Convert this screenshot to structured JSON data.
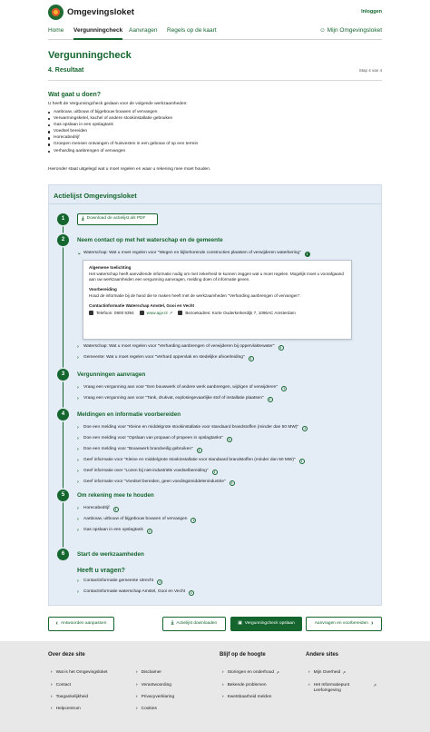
{
  "header": {
    "brand": "Omgevingsloket",
    "login": "Inloggen",
    "nav": [
      "Home",
      "Vergunningcheck",
      "Aanvragen",
      "Regels op de kaart"
    ],
    "mijn": "Mijn Omgevingsloket"
  },
  "page": {
    "title": "Vergunningcheck",
    "subtitle": "4. Resultaat",
    "step": "Stap 4 van 4"
  },
  "intro": {
    "heading": "Wat gaat u doen?",
    "text": "U heeft de Vergunningcheck gedaan voor de volgende werkzaamheden:",
    "bullets": [
      "Aanbouw, uitbouw of bijgebouw bouwen of vervangen",
      "Verwarmingsketel, kachel of andere stookinstallatie gebruiken",
      "Gas opslaan in een opslagtank",
      "Voedsel bereiden",
      "Horecabedrijf",
      "Groepen mensen ontvangen of huisvesten in een gebouw of op een terrein",
      "Verharding aanbrengen of vervangen"
    ],
    "outro": "Hieronder staat uitgelegd wat u moet regelen en waar u rekening mee moet houden."
  },
  "actielijst": {
    "title": "Actielijst Omgevingsloket",
    "step1": {
      "num": "1",
      "button": "Download de actielijst als PDF"
    },
    "step2": {
      "num": "2",
      "title": "Neem contact op met het waterschap en de gemeente",
      "open_item": "Waterschap: Wat u moet regelen voor \"Wegen en bijbehorende constructies plaatsen of verwijderen waterkering\"",
      "box": {
        "h1": "Algemene toelichting",
        "p1": "Het waterschap heeft aanvullende informatie nodig om met zekerheid te kunnen zeggen wat u moet regelen. Mogelijk moet u vooraf­gaand aan uw werkzaamheden een vergunning aanvragen, melding doen of informatie geven.",
        "h2": "Voorbereiding",
        "p2": "Houd de informatie bij de hand die te maken heeft met de werkzaamheden \"Verharding aanbrengen of vervangen\".",
        "h3": "Contactinformatie Waterschap Amstel, Gooi en Vecht",
        "phone": "Telefoon: 0900 9394",
        "web": "www.agv.nl",
        "address": "Bezoekadres: Korte Ouderkerkerdijk 7, 1096AC Amsterdam"
      },
      "items": [
        "Waterschap: Wat u moet regelen voor \"Verharding aanbrengen of verwijderen bij oppervlaktewater\"",
        "Gemeente: Wat u moet regelen voor \"Verhard oppervlak en stedelijke afvoerleiding\""
      ]
    },
    "step3": {
      "num": "3",
      "title": "Vergunningen aanvragen",
      "items": [
        "Vraag een vergunning aan voor \"Een bouwwerk of andere werk aanbrengen, wijzigen of verwijderen\"",
        "Vraag een vergunning aan voor \"Tank, drukvat, explosiegevaarlijke stof of installatie plaatsen\""
      ]
    },
    "step4": {
      "num": "4",
      "title": "Meldingen en informatie voorbereiden",
      "items": [
        "Doe een melding voor \"Kleine en middelgrote stookinstallatie voor standaard brandstoffen (minder dan 50 MW)\"",
        "Doe een melding voor \"Opslaan van propaan of propeen in opslagtanks\"",
        "Doe een melding voor \"Bouwwerk brandveilig gebruiken\"",
        "Geef informatie voor \"Kleine en middelgrote stookinstallatie voor standaard brandstoffen (minder dan 50 MW)\"",
        "Geef informatie over \"Lozen bij niet-industriële voedselbereiding\"",
        "Geef informatie voor \"Voedsel bereiden, geen voedingsmiddelenindustrie\""
      ]
    },
    "step5": {
      "num": "5",
      "title": "Om rekening mee te houden",
      "items": [
        "Horecabedrijf",
        "Aanbouw, uitbouw of bijgebouw bouwen of vervangen",
        "Gas opslaan in een opslagtank"
      ]
    },
    "step6": {
      "num": "6",
      "title": "Start de werkzaamheden",
      "question": "Heeft u vragen?",
      "items": [
        "Contactinformatie gemeente Utrecht",
        "Contactinformatie waterschap Amstel, Gooi en Vecht"
      ]
    }
  },
  "buttons": {
    "back": "Antwoorden aanpassen",
    "download": "Actielijst downloaden",
    "save": "Vergunningcheck opslaan",
    "next": "Aanvragen en voorbereiden"
  },
  "footer": {
    "col1_title": "Over deze site",
    "col1a": [
      "Wat is het Omgevingsloket",
      "Contact",
      "Toegankelijkheid",
      "Helpcentrum"
    ],
    "col1b": [
      "Disclaimer",
      "Verantwoording",
      "Privacyverklaring",
      "Cookies"
    ],
    "col2_title": "Blijf op de hoogte",
    "col2": [
      "Storingen en onderhoud",
      "Bekende problemen",
      "Kwetsbaarheid melden"
    ],
    "col3_title": "Andere sites",
    "col3": [
      "Mijn Overheid",
      "Het Informatiepunt Leefomgeving"
    ]
  },
  "colors": {
    "primary_green": "#15662e",
    "panel_bg": "#e4ecf5",
    "footer_bg": "#e8e8e8"
  }
}
